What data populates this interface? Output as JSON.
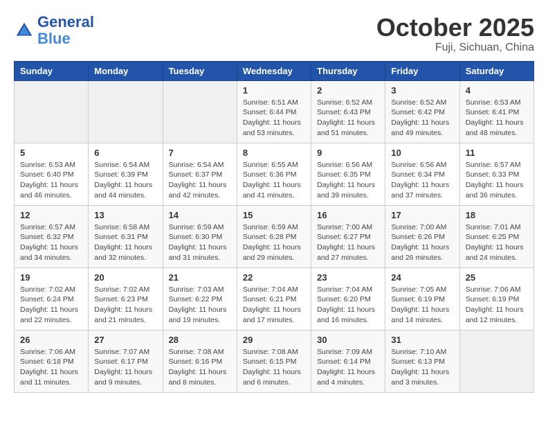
{
  "header": {
    "logo_line1": "General",
    "logo_line2": "Blue",
    "month": "October 2025",
    "location": "Fuji, Sichuan, China"
  },
  "weekdays": [
    "Sunday",
    "Monday",
    "Tuesday",
    "Wednesday",
    "Thursday",
    "Friday",
    "Saturday"
  ],
  "weeks": [
    [
      {
        "day": "",
        "info": ""
      },
      {
        "day": "",
        "info": ""
      },
      {
        "day": "",
        "info": ""
      },
      {
        "day": "1",
        "info": "Sunrise: 6:51 AM\nSunset: 6:44 PM\nDaylight: 11 hours\nand 53 minutes."
      },
      {
        "day": "2",
        "info": "Sunrise: 6:52 AM\nSunset: 6:43 PM\nDaylight: 11 hours\nand 51 minutes."
      },
      {
        "day": "3",
        "info": "Sunrise: 6:52 AM\nSunset: 6:42 PM\nDaylight: 11 hours\nand 49 minutes."
      },
      {
        "day": "4",
        "info": "Sunrise: 6:53 AM\nSunset: 6:41 PM\nDaylight: 11 hours\nand 48 minutes."
      }
    ],
    [
      {
        "day": "5",
        "info": "Sunrise: 6:53 AM\nSunset: 6:40 PM\nDaylight: 11 hours\nand 46 minutes."
      },
      {
        "day": "6",
        "info": "Sunrise: 6:54 AM\nSunset: 6:39 PM\nDaylight: 11 hours\nand 44 minutes."
      },
      {
        "day": "7",
        "info": "Sunrise: 6:54 AM\nSunset: 6:37 PM\nDaylight: 11 hours\nand 42 minutes."
      },
      {
        "day": "8",
        "info": "Sunrise: 6:55 AM\nSunset: 6:36 PM\nDaylight: 11 hours\nand 41 minutes."
      },
      {
        "day": "9",
        "info": "Sunrise: 6:56 AM\nSunset: 6:35 PM\nDaylight: 11 hours\nand 39 minutes."
      },
      {
        "day": "10",
        "info": "Sunrise: 6:56 AM\nSunset: 6:34 PM\nDaylight: 11 hours\nand 37 minutes."
      },
      {
        "day": "11",
        "info": "Sunrise: 6:57 AM\nSunset: 6:33 PM\nDaylight: 11 hours\nand 36 minutes."
      }
    ],
    [
      {
        "day": "12",
        "info": "Sunrise: 6:57 AM\nSunset: 6:32 PM\nDaylight: 11 hours\nand 34 minutes."
      },
      {
        "day": "13",
        "info": "Sunrise: 6:58 AM\nSunset: 6:31 PM\nDaylight: 11 hours\nand 32 minutes."
      },
      {
        "day": "14",
        "info": "Sunrise: 6:59 AM\nSunset: 6:30 PM\nDaylight: 11 hours\nand 31 minutes."
      },
      {
        "day": "15",
        "info": "Sunrise: 6:59 AM\nSunset: 6:28 PM\nDaylight: 11 hours\nand 29 minutes."
      },
      {
        "day": "16",
        "info": "Sunrise: 7:00 AM\nSunset: 6:27 PM\nDaylight: 11 hours\nand 27 minutes."
      },
      {
        "day": "17",
        "info": "Sunrise: 7:00 AM\nSunset: 6:26 PM\nDaylight: 11 hours\nand 26 minutes."
      },
      {
        "day": "18",
        "info": "Sunrise: 7:01 AM\nSunset: 6:25 PM\nDaylight: 11 hours\nand 24 minutes."
      }
    ],
    [
      {
        "day": "19",
        "info": "Sunrise: 7:02 AM\nSunset: 6:24 PM\nDaylight: 11 hours\nand 22 minutes."
      },
      {
        "day": "20",
        "info": "Sunrise: 7:02 AM\nSunset: 6:23 PM\nDaylight: 11 hours\nand 21 minutes."
      },
      {
        "day": "21",
        "info": "Sunrise: 7:03 AM\nSunset: 6:22 PM\nDaylight: 11 hours\nand 19 minutes."
      },
      {
        "day": "22",
        "info": "Sunrise: 7:04 AM\nSunset: 6:21 PM\nDaylight: 11 hours\nand 17 minutes."
      },
      {
        "day": "23",
        "info": "Sunrise: 7:04 AM\nSunset: 6:20 PM\nDaylight: 11 hours\nand 16 minutes."
      },
      {
        "day": "24",
        "info": "Sunrise: 7:05 AM\nSunset: 6:19 PM\nDaylight: 11 hours\nand 14 minutes."
      },
      {
        "day": "25",
        "info": "Sunrise: 7:06 AM\nSunset: 6:19 PM\nDaylight: 11 hours\nand 12 minutes."
      }
    ],
    [
      {
        "day": "26",
        "info": "Sunrise: 7:06 AM\nSunset: 6:18 PM\nDaylight: 11 hours\nand 11 minutes."
      },
      {
        "day": "27",
        "info": "Sunrise: 7:07 AM\nSunset: 6:17 PM\nDaylight: 11 hours\nand 9 minutes."
      },
      {
        "day": "28",
        "info": "Sunrise: 7:08 AM\nSunset: 6:16 PM\nDaylight: 11 hours\nand 8 minutes."
      },
      {
        "day": "29",
        "info": "Sunrise: 7:08 AM\nSunset: 6:15 PM\nDaylight: 11 hours\nand 6 minutes."
      },
      {
        "day": "30",
        "info": "Sunrise: 7:09 AM\nSunset: 6:14 PM\nDaylight: 11 hours\nand 4 minutes."
      },
      {
        "day": "31",
        "info": "Sunrise: 7:10 AM\nSunset: 6:13 PM\nDaylight: 11 hours\nand 3 minutes."
      },
      {
        "day": "",
        "info": ""
      }
    ]
  ]
}
